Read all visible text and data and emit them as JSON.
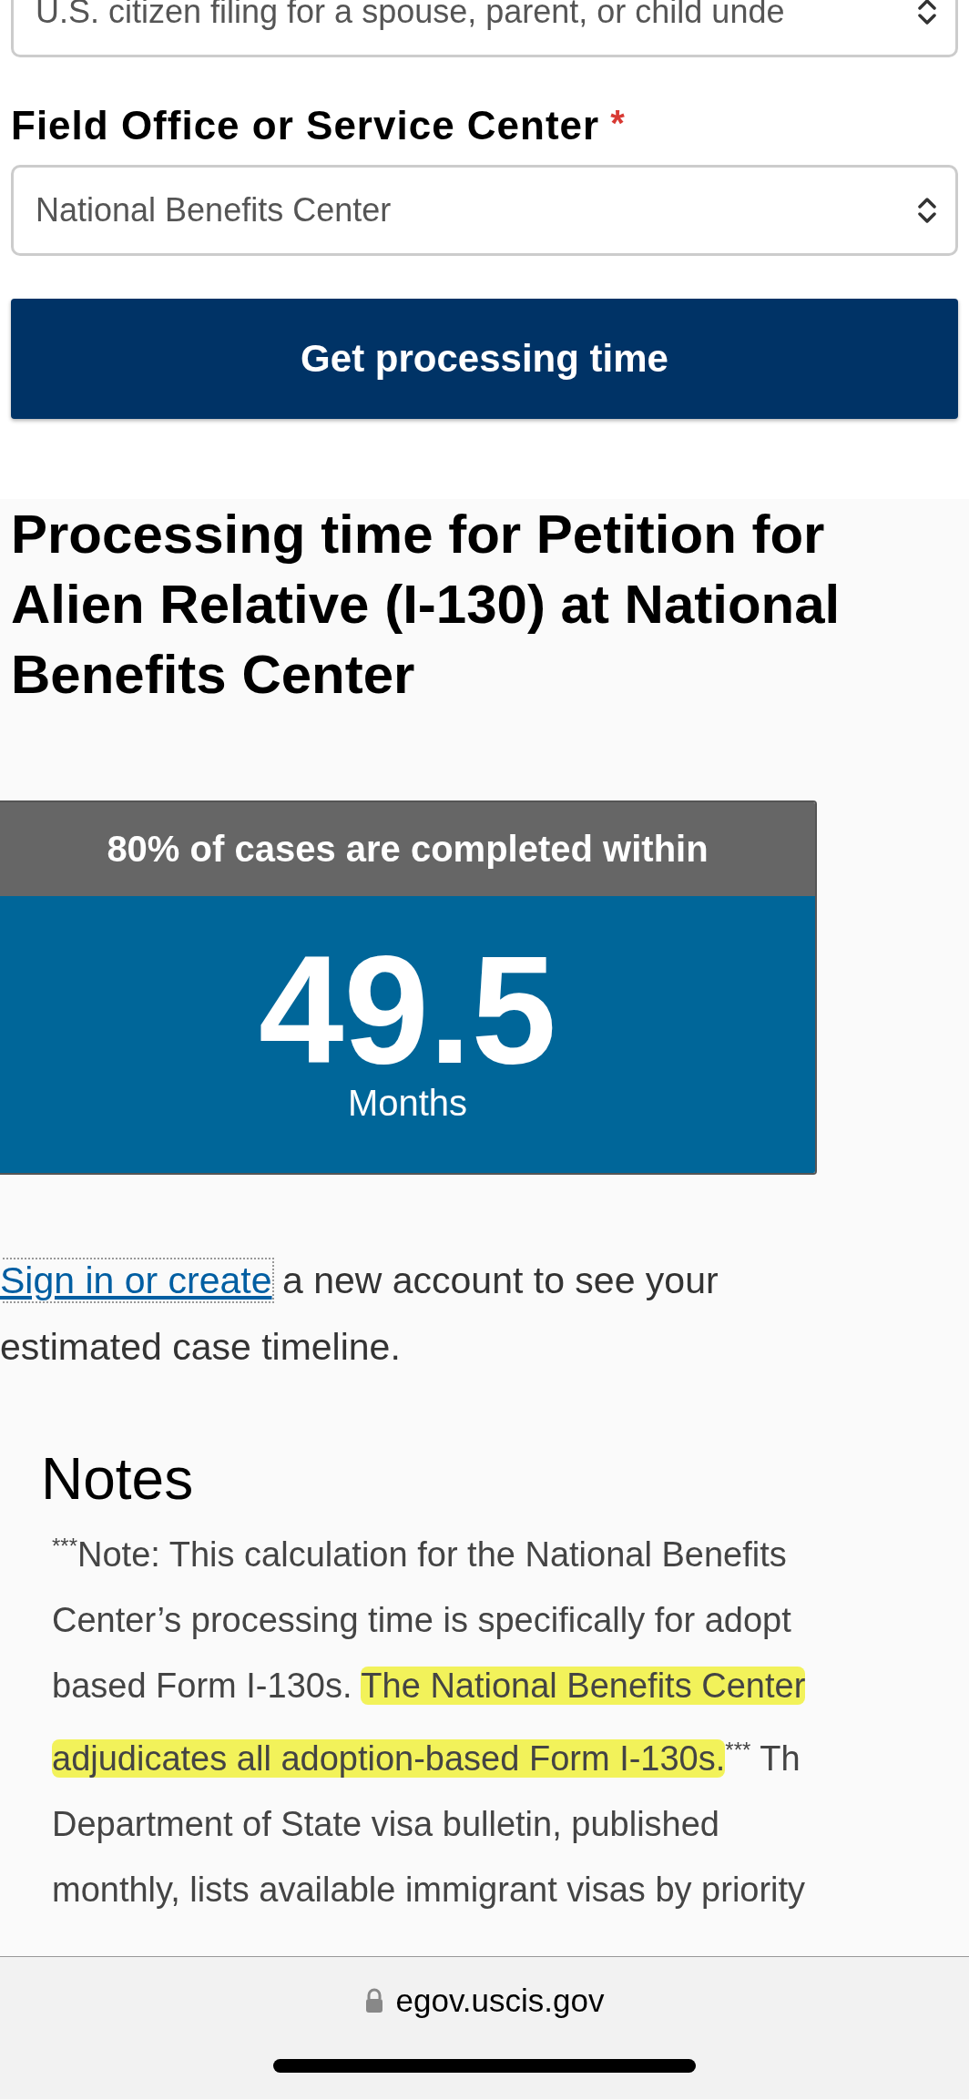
{
  "case_type_select": {
    "value": "U.S. citizen filing for a spouse, parent, or child unde"
  },
  "office_field": {
    "label": "Field Office or Service Center",
    "required_mark": "*",
    "value": "National Benefits Center"
  },
  "submit_button": "Get processing time",
  "result": {
    "heading": "Processing time for Petition for Alien Relative (I-130) at National Benefits Center",
    "card_header": "80% of cases are completed within",
    "value": "49.5",
    "unit": "Months"
  },
  "account_prompt": {
    "link": "Sign in or create",
    "text": "a new account to see your estimated case timeline."
  },
  "notes": {
    "title": "Notes",
    "lines": [
      {
        "segments": [
          {
            "text": "$^{***}$Note: This calculation for the National Benefits",
            "highlighted": false
          }
        ]
      },
      {
        "segments": [
          {
            "text": "Center’s processing time is specifically for adopt",
            "highlighted": false
          }
        ]
      },
      {
        "segments": [
          {
            "text": "based Form I-130s. ",
            "highlighted": false
          },
          {
            "text": "The National Benefits Center",
            "highlighted": true
          }
        ]
      },
      {
        "segments": [
          {
            "text": "adjudicates all adoption-based Form I-130s.",
            "highlighted": true
          },
          {
            "text": "$^{***}$ Th",
            "highlighted": false
          }
        ]
      },
      {
        "segments": [
          {
            "text": "Department of State visa bulletin, published",
            "highlighted": false
          }
        ]
      },
      {
        "segments": [
          {
            "text": "monthly, lists available immigrant visas by priority",
            "highlighted": false
          }
        ]
      }
    ]
  },
  "browser_bar": {
    "url": "egov.uscis.gov"
  }
}
